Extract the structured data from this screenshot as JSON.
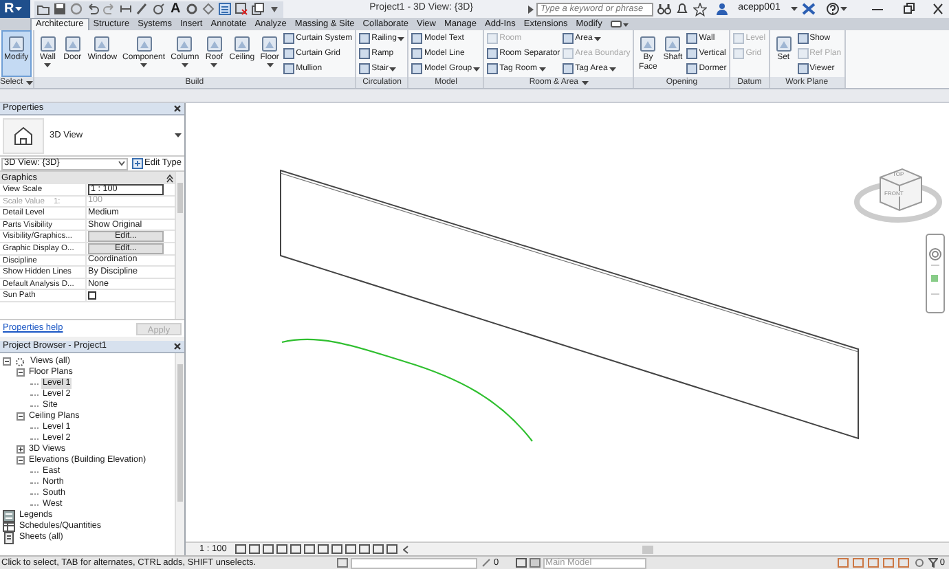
{
  "app": {
    "app_button": "R",
    "quick_access_text": "A",
    "title": "Project1 - 3D View: {3D}",
    "search": {
      "placeholder": "Type a keyword or phrase"
    },
    "user": "acepp001"
  },
  "ribbon_tabs": [
    {
      "label": "Architecture",
      "selected": true
    },
    {
      "label": "Structure",
      "selected": false
    },
    {
      "label": "Systems",
      "selected": false
    },
    {
      "label": "Insert",
      "selected": false
    },
    {
      "label": "Annotate",
      "selected": false
    },
    {
      "label": "Analyze",
      "selected": false
    },
    {
      "label": "Massing & Site",
      "selected": false
    },
    {
      "label": "Collaborate",
      "selected": false
    },
    {
      "label": "View",
      "selected": false
    },
    {
      "label": "Manage",
      "selected": false
    },
    {
      "label": "Add-Ins",
      "selected": false
    },
    {
      "label": "Extensions",
      "selected": false
    },
    {
      "label": "Modify",
      "selected": false
    }
  ],
  "ribbon_panels": [
    {
      "label": "Select",
      "menu": true,
      "tools": [
        {
          "kind": "large",
          "label": "Modify",
          "menu": false,
          "disabled": false,
          "selected": true
        }
      ]
    },
    {
      "label": "Build",
      "menu": false,
      "tools": [
        {
          "kind": "large",
          "label": "Wall",
          "menu": true,
          "disabled": false,
          "selected": false
        },
        {
          "kind": "large",
          "label": "Door",
          "menu": false,
          "disabled": false,
          "selected": false
        },
        {
          "kind": "large",
          "label": "Window",
          "menu": false,
          "disabled": false,
          "selected": false
        },
        {
          "kind": "large",
          "label": "Component",
          "menu": true,
          "disabled": false,
          "selected": false
        },
        {
          "kind": "large",
          "label": "Column",
          "menu": true,
          "disabled": false,
          "selected": false
        },
        {
          "kind": "large",
          "label": "Roof",
          "menu": true,
          "disabled": false,
          "selected": false
        },
        {
          "kind": "large",
          "label": "Ceiling",
          "menu": false,
          "disabled": false,
          "selected": false
        },
        {
          "kind": "large",
          "label": "Floor",
          "menu": true,
          "disabled": false,
          "selected": false
        },
        {
          "kind": "small",
          "label": "Curtain System",
          "menu": false,
          "disabled": false,
          "selected": false
        },
        {
          "kind": "small",
          "label": "Curtain Grid",
          "menu": false,
          "disabled": false,
          "selected": false
        },
        {
          "kind": "small",
          "label": "Mullion",
          "menu": false,
          "disabled": false,
          "selected": false
        }
      ]
    },
    {
      "label": "Circulation",
      "menu": false,
      "tools": [
        {
          "kind": "small",
          "label": "Railing",
          "menu": true,
          "disabled": false,
          "selected": false
        },
        {
          "kind": "small",
          "label": "Ramp",
          "menu": false,
          "disabled": false,
          "selected": false
        },
        {
          "kind": "small",
          "label": "Stair",
          "menu": true,
          "disabled": false,
          "selected": false
        }
      ]
    },
    {
      "label": "Model",
      "menu": false,
      "tools": [
        {
          "kind": "small",
          "label": "Model Text",
          "menu": false,
          "disabled": false,
          "selected": false
        },
        {
          "kind": "small",
          "label": "Model Line",
          "menu": false,
          "disabled": false,
          "selected": false
        },
        {
          "kind": "small",
          "label": "Model Group",
          "menu": true,
          "disabled": false,
          "selected": false
        }
      ]
    },
    {
      "label": "Room & Area",
      "menu": true,
      "tools": [
        {
          "kind": "small",
          "label": "Room",
          "menu": false,
          "disabled": true,
          "selected": false
        },
        {
          "kind": "small",
          "label": "Room Separator",
          "menu": false,
          "disabled": false,
          "selected": false
        },
        {
          "kind": "small",
          "label": "Tag Room",
          "menu": true,
          "disabled": false,
          "selected": false
        },
        {
          "kind": "small",
          "label": "Area",
          "menu": true,
          "disabled": false,
          "selected": false
        },
        {
          "kind": "small",
          "label": "Area Boundary",
          "menu": false,
          "disabled": true,
          "selected": false
        },
        {
          "kind": "small",
          "label": "Tag Area",
          "menu": true,
          "disabled": false,
          "selected": false
        }
      ]
    },
    {
      "label": "Opening",
      "menu": false,
      "tools": [
        {
          "kind": "large",
          "label": "By Face",
          "menu": false,
          "disabled": false,
          "selected": false
        },
        {
          "kind": "large",
          "label": "Shaft",
          "menu": false,
          "disabled": false,
          "selected": false
        },
        {
          "kind": "small",
          "label": "Wall",
          "menu": false,
          "disabled": false,
          "selected": false
        },
        {
          "kind": "small",
          "label": "Vertical",
          "menu": false,
          "disabled": false,
          "selected": false
        },
        {
          "kind": "small",
          "label": "Dormer",
          "menu": false,
          "disabled": false,
          "selected": false
        }
      ]
    },
    {
      "label": "Datum",
      "menu": false,
      "tools": [
        {
          "kind": "small",
          "label": "Level",
          "menu": false,
          "disabled": true,
          "selected": false
        },
        {
          "kind": "small",
          "label": "Grid",
          "menu": false,
          "disabled": true,
          "selected": false
        }
      ]
    },
    {
      "label": "Work Plane",
      "menu": false,
      "tools": [
        {
          "kind": "large",
          "label": "Set",
          "menu": false,
          "disabled": false,
          "selected": false
        },
        {
          "kind": "small",
          "label": "Show",
          "menu": false,
          "disabled": false,
          "selected": false
        },
        {
          "kind": "small",
          "label": "Ref Plan",
          "menu": false,
          "disabled": true,
          "selected": false
        },
        {
          "kind": "small",
          "label": "Viewer",
          "menu": false,
          "disabled": false,
          "selected": false
        }
      ]
    }
  ],
  "properties": {
    "title": "Properties",
    "type_name": "3D View",
    "instance": "3D View: {3D}",
    "edit_type": "Edit Type",
    "group": "Graphics",
    "rows": [
      {
        "kind": "input",
        "label": "View Scale",
        "value": "1 : 100",
        "disabled": false
      },
      {
        "kind": "text",
        "label": "Scale Value    1:",
        "value": "100",
        "disabled": true
      },
      {
        "kind": "text",
        "label": "Detail Level",
        "value": "Medium",
        "disabled": false
      },
      {
        "kind": "text",
        "label": "Parts Visibility",
        "value": "Show Original",
        "disabled": false
      },
      {
        "kind": "button",
        "label": "Visibility/Graphics...",
        "value": "Edit...",
        "disabled": false
      },
      {
        "kind": "button",
        "label": "Graphic Display O...",
        "value": "Edit...",
        "disabled": false
      },
      {
        "kind": "text",
        "label": "Discipline",
        "value": "Coordination",
        "disabled": false
      },
      {
        "kind": "text",
        "label": "Show Hidden Lines",
        "value": "By Discipline",
        "disabled": false
      },
      {
        "kind": "text",
        "label": "Default Analysis D...",
        "value": "None",
        "disabled": false
      },
      {
        "kind": "checkbox",
        "label": "Sun Path",
        "checked": false,
        "disabled": false
      }
    ],
    "help_link": "Properties help",
    "apply": {
      "label": "Apply",
      "disabled": true
    }
  },
  "project_browser": {
    "title": "Project Browser - Project1",
    "tree": [
      {
        "kind": "views",
        "label": "Views (all)",
        "expanded": true,
        "selected": false,
        "children": [
          {
            "label": "Floor Plans",
            "expanded": true,
            "selected": false,
            "children": [
              {
                "label": "Level 1",
                "selected": true
              },
              {
                "label": "Level 2",
                "selected": false
              },
              {
                "label": "Site",
                "selected": false
              }
            ]
          },
          {
            "label": "Ceiling Plans",
            "expanded": true,
            "selected": false,
            "children": [
              {
                "label": "Level 1",
                "selected": false
              },
              {
                "label": "Level 2",
                "selected": false
              }
            ]
          },
          {
            "label": "3D Views",
            "expanded": false,
            "selected": false
          },
          {
            "label": "Elevations (Building Elevation)",
            "expanded": true,
            "selected": false,
            "children": [
              {
                "label": "East",
                "selected": false
              },
              {
                "label": "North",
                "selected": false
              },
              {
                "label": "South",
                "selected": false
              },
              {
                "label": "West",
                "selected": false
              }
            ]
          }
        ]
      },
      {
        "kind": "legend",
        "label": "Legends",
        "selected": false
      },
      {
        "kind": "schedule",
        "label": "Schedules/Quantities",
        "selected": false
      },
      {
        "kind": "sheet",
        "label": "Sheets (all)",
        "selected": false
      }
    ]
  },
  "view": {
    "scale": "1 : 100",
    "view_cube": {
      "top": "TOP",
      "front": "FRONT"
    }
  },
  "status_bar": {
    "message": "Click to select, TAB for alternates, CTRL adds, SHIFT unselects.",
    "count": "0",
    "model": "Main Model",
    "filter_count": "0"
  }
}
